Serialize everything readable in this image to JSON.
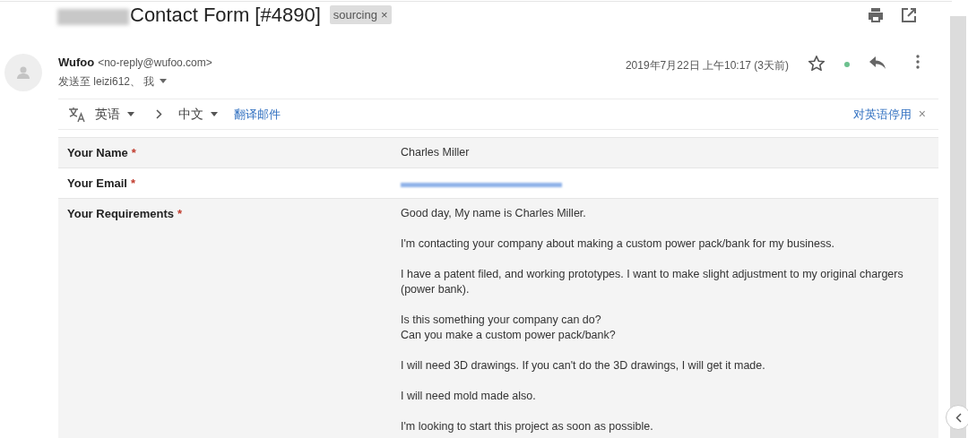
{
  "subject": {
    "title": "Contact Form [#4890]",
    "label": "sourcing",
    "label_close": "×"
  },
  "sender": {
    "name": "Wufoo",
    "email": "<no-reply@wufoo.com>",
    "recipients": "发送至 leizi612、 我",
    "date": "2019年7月22日 上午10:17 (3天前)",
    "starred": false
  },
  "translate": {
    "from": "英语",
    "to": "中文",
    "action": "翻译邮件",
    "disable": "对英语停用",
    "close": "×"
  },
  "fields": [
    {
      "label": "Your Name",
      "required_mark": "*",
      "kind": "text",
      "paragraphs": [
        [
          "Charles Miller"
        ]
      ]
    },
    {
      "label": "Your Email",
      "required_mark": "*",
      "kind": "redacted"
    },
    {
      "label": "Your Requirements",
      "required_mark": "*",
      "kind": "text",
      "paragraphs": [
        [
          "Good day, My name is Charles Miller."
        ],
        [
          "I'm contacting your company about making a custom power pack/bank for my business."
        ],
        [
          "I have a patent filed, and working prototypes. I want to make slight adjustment to my original chargers (power bank)."
        ],
        [
          "Is this something your company can do?",
          "Can you make a custom power pack/bank?"
        ],
        [
          "I will need 3D drawings. If you can't do the 3D drawings, I will get it made."
        ],
        [
          "I will need mold made also."
        ],
        [
          "I'm looking to start this project as soon as possible."
        ]
      ]
    }
  ]
}
